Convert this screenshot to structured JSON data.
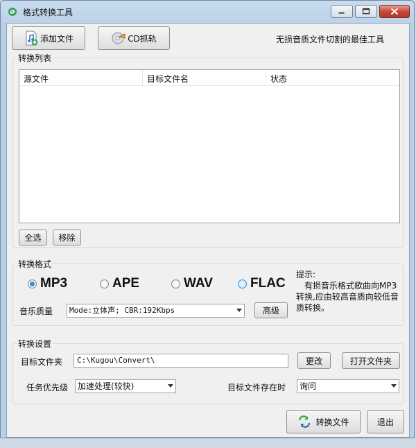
{
  "window": {
    "title": "格式转换工具"
  },
  "toolbar": {
    "add_file_label": "添加文件",
    "cd_rip_label": "CD抓轨",
    "tagline": "无损音质文件切割的最佳工具"
  },
  "list_group": {
    "title": "转换列表",
    "columns": [
      "源文件",
      "目标文件名",
      "状态"
    ],
    "select_all_label": "全选",
    "remove_label": "移除"
  },
  "format_group": {
    "title": "转换格式",
    "formats": [
      "MP3",
      "APE",
      "WAV",
      "FLAC"
    ],
    "selected": "MP3",
    "quality_label": "音乐质量",
    "quality_value": "Mode:立体声; CBR:192Kbps",
    "advanced_label": "高级",
    "hint_title": "提示:",
    "hint_text": "有损音乐格式歌曲向MP3转换,应由较高音质向较低音质转换。"
  },
  "settings_group": {
    "title": "转换设置",
    "target_folder_label": "目标文件夹",
    "target_folder_value": "C:\\Kugou\\Convert\\",
    "change_label": "更改",
    "open_folder_label": "打开文件夹",
    "priority_label": "任务优先级",
    "priority_value": "加速处理(较快)",
    "exists_label": "目标文件存在时",
    "exists_value": "询问"
  },
  "footer": {
    "convert_label": "转换文件",
    "exit_label": "退出"
  },
  "colors": {
    "accent": "#3f8ad8",
    "window_frame": "#b9cfe6",
    "close_button": "#c4483a"
  }
}
